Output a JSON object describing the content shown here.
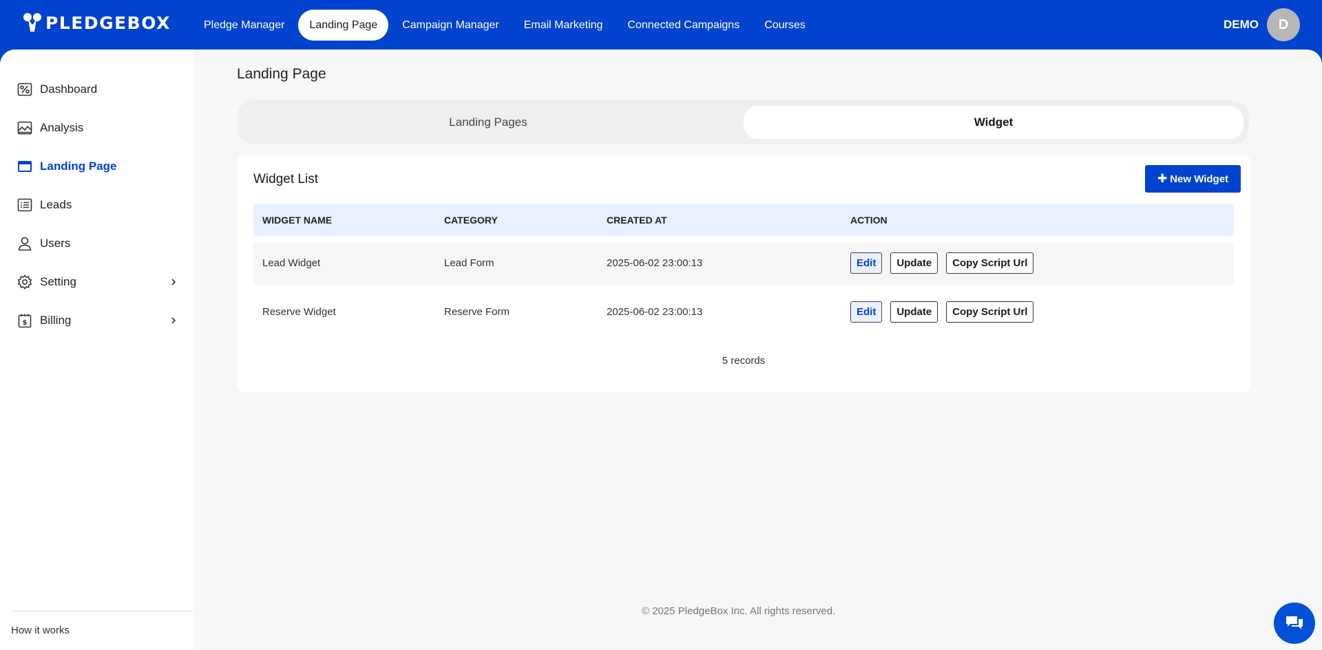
{
  "brand": {
    "name": "PLEDGEBOX"
  },
  "topnav": {
    "items": [
      {
        "label": "Pledge Manager",
        "active": false
      },
      {
        "label": "Landing Page",
        "active": true
      },
      {
        "label": "Campaign Manager",
        "active": false
      },
      {
        "label": "Email Marketing",
        "active": false
      },
      {
        "label": "Connected Campaigns",
        "active": false
      },
      {
        "label": "Courses",
        "active": false
      }
    ]
  },
  "user": {
    "name": "DEMO",
    "initial": "D"
  },
  "sidebar": {
    "items": [
      {
        "label": "Dashboard",
        "icon": "dashboard-icon"
      },
      {
        "label": "Analysis",
        "icon": "chart-image-icon"
      },
      {
        "label": "Landing Page",
        "icon": "browser-window-icon",
        "active": true
      },
      {
        "label": "Leads",
        "icon": "list-icon"
      },
      {
        "label": "Users",
        "icon": "user-icon"
      },
      {
        "label": "Setting",
        "icon": "gear-icon",
        "has_submenu": true
      },
      {
        "label": "Billing",
        "icon": "billing-icon",
        "has_submenu": true
      }
    ],
    "how_it_works": "How it works"
  },
  "page": {
    "title": "Landing Page",
    "tabs": [
      {
        "label": "Landing Pages",
        "active": false
      },
      {
        "label": "Widget",
        "active": true
      }
    ]
  },
  "widget_list": {
    "title": "Widget List",
    "new_button": "New Widget",
    "columns": [
      "WIDGET NAME",
      "CATEGORY",
      "CREATED AT",
      "ACTION"
    ],
    "rows": [
      {
        "name": "Lead Widget",
        "category": "Lead Form",
        "created_at": "2025-06-02 23:00:13"
      },
      {
        "name": "Reserve Widget",
        "category": "Reserve Form",
        "created_at": "2025-06-02 23:00:13"
      }
    ],
    "actions": {
      "edit": "Edit",
      "update": "Update",
      "copy": "Copy Script Url"
    },
    "records": "5 records"
  },
  "footer": {
    "copyright": "© 2025 PledgeBox Inc. All rights reserved."
  },
  "colors": {
    "primary": "#0043ce",
    "header_bg": "#e8f1fd",
    "page_bg": "#f6f7f9"
  }
}
